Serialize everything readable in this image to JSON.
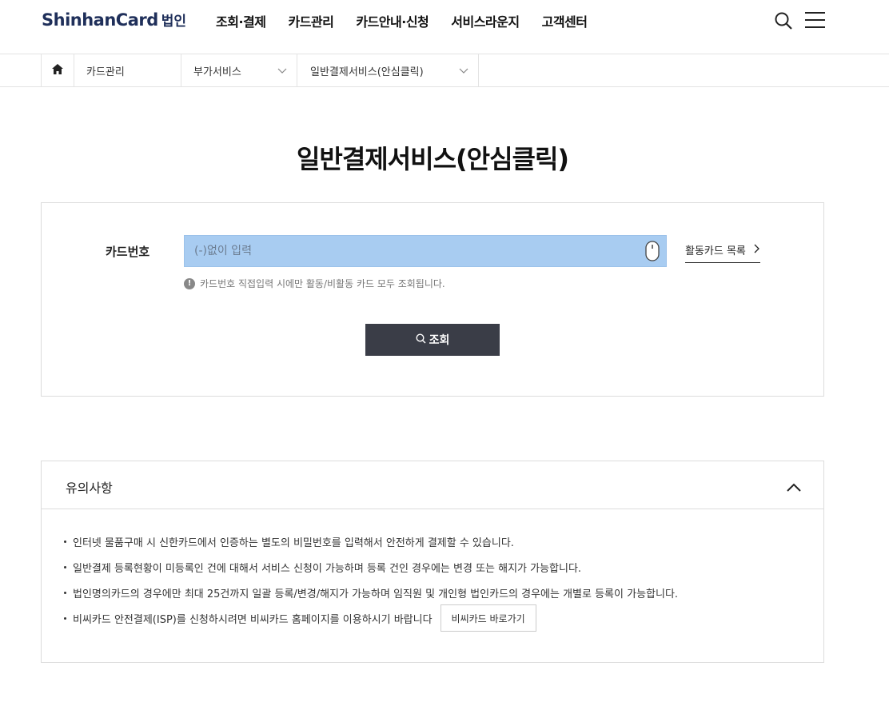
{
  "header": {
    "logo_main": "ShinhanCard",
    "logo_sub": "법인",
    "nav": [
      "조회·결제",
      "카드관리",
      "카드안내·신청",
      "서비스라운지",
      "고객센터"
    ]
  },
  "breadcrumb": {
    "level1": "카드관리",
    "level2": "부가서비스",
    "level3": "일반결제서비스(안심클릭)"
  },
  "page": {
    "title": "일반결제서비스(안심클릭)"
  },
  "search": {
    "card_label": "카드번호",
    "card_placeholder": "(-)없이 입력",
    "active_cards_link": "활동카드 목록",
    "notice": "카드번호 직접입력 시에만 활동/비활동 카드 모두 조회됩니다.",
    "submit_label": "조회"
  },
  "notes": {
    "title": "유의사항",
    "items": [
      "인터넷 물품구매 시 신한카드에서 인증하는 별도의 비밀번호를 입력해서 안전하게 결제할 수 있습니다.",
      "일반결제 등록현황이 미등록인 건에 대해서 서비스 신청이 가능하며 등록 건인 경우에는 변경 또는 해지가 가능합니다.",
      "법인명의카드의 경우에만 최대 25건까지 일괄 등록/변경/해지가 가능하며 임직원 및 개인형 법인카드의 경우에는 개별로 등록이 가능합니다.",
      "비씨카드 안전결제(ISP)를 신청하시려면 비씨카드 홈페이지를 이용하시기 바랍니다"
    ],
    "bc_button": "비씨카드 바로가기"
  },
  "colors": {
    "brand": "#1f2f5a",
    "input_highlight": "#a8ccf1",
    "button_dark": "#3a3d47"
  }
}
